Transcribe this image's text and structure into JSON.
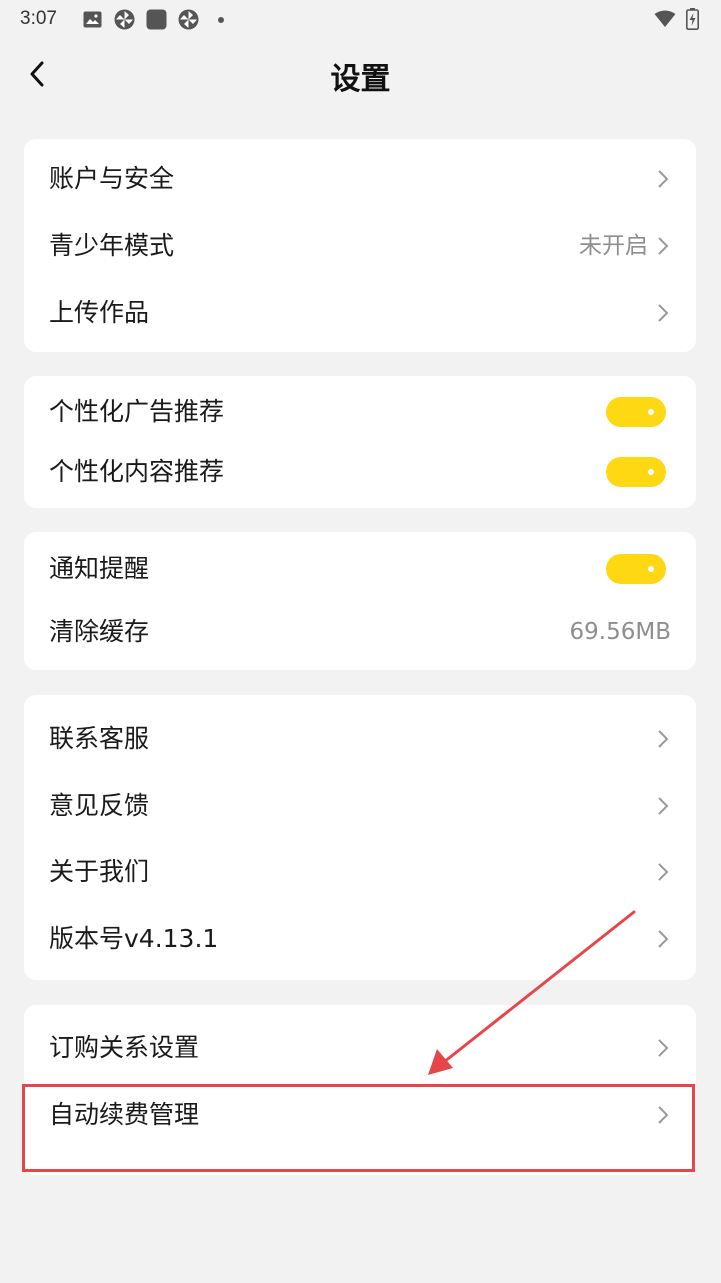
{
  "status_bar": {
    "time": "3:07",
    "left_icons": [
      "image-icon",
      "pinwheel-icon",
      "square-app-icon",
      "pinwheel-icon",
      "dot-icon"
    ],
    "right_icons": [
      "wifi-icon",
      "battery-charging-icon"
    ]
  },
  "header": {
    "title": "设置",
    "back_icon": "chevron-left-icon"
  },
  "sections": {
    "account": {
      "items": [
        {
          "label": "账户与安全"
        },
        {
          "label": "青少年模式",
          "value": "未开启"
        },
        {
          "label": "上传作品"
        }
      ]
    },
    "recommend": {
      "items": [
        {
          "label": "个性化广告推荐",
          "toggle_on": true
        },
        {
          "label": "个性化内容推荐",
          "toggle_on": true
        }
      ]
    },
    "notify": {
      "items": [
        {
          "label": "通知提醒",
          "toggle_on": true
        },
        {
          "label": "清除缓存",
          "value": "69.56MB"
        }
      ]
    },
    "about": {
      "items": [
        {
          "label": "联系客服"
        },
        {
          "label": "意见反馈"
        },
        {
          "label": "关于我们"
        },
        {
          "label": "版本号v4.13.1"
        }
      ]
    },
    "subscription": {
      "items": [
        {
          "label": "订购关系设置"
        },
        {
          "label": "自动续费管理"
        }
      ]
    }
  },
  "colors": {
    "background": "#f2f2f2",
    "card": "#ffffff",
    "toggle_on": "#ffd814",
    "annotation": "#e8454b",
    "secondary_text": "#8e8e8e"
  }
}
